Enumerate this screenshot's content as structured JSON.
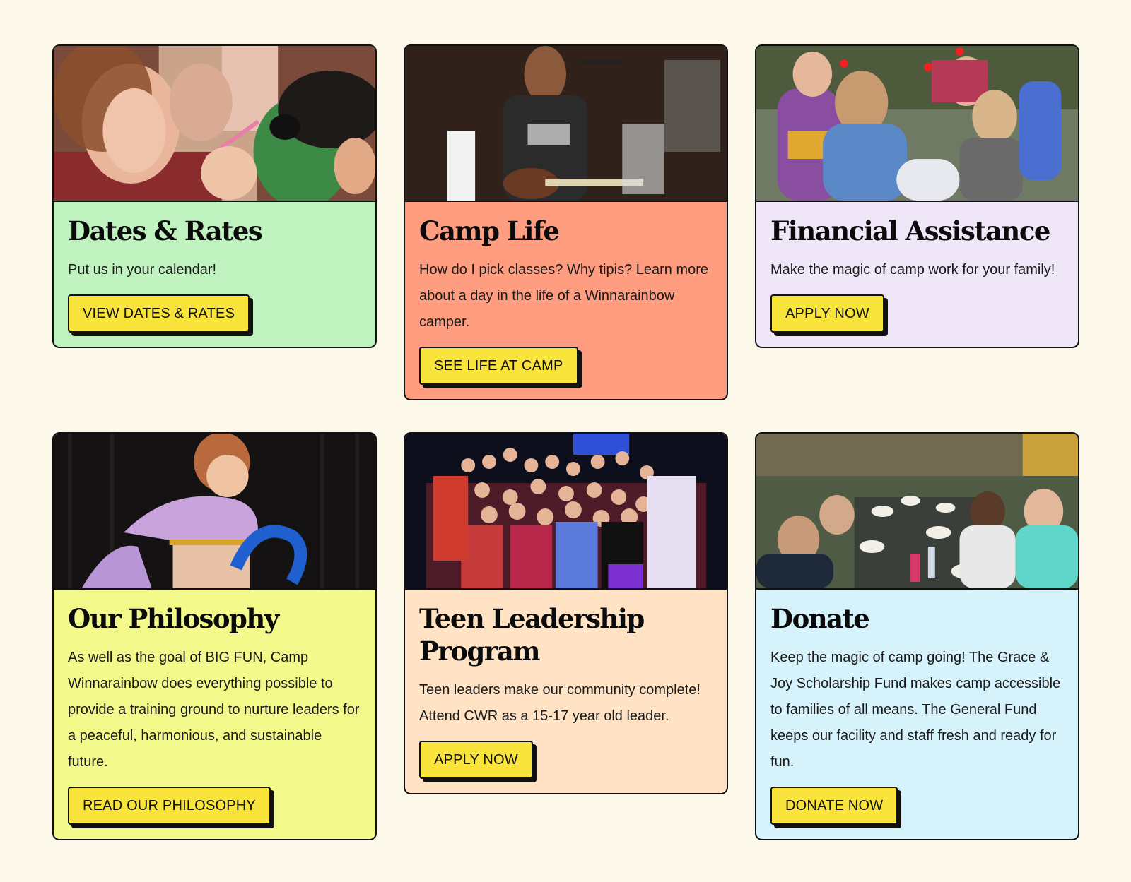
{
  "colors": {
    "background": "#fcf9ea",
    "button": "#f9e43b",
    "border": "#111111",
    "card_green": "#c0f2c0",
    "card_salmon": "#ff9d80",
    "card_lavender": "#efe6f8",
    "card_yellow": "#f2f88a",
    "card_peach": "#ffe3c4",
    "card_lightblue": "#d6f2fb"
  },
  "cards": [
    {
      "title": "Dates & Rates",
      "body": "Put us in your calendar!",
      "button": "VIEW DATES & RATES",
      "photo": "camper-face-painting-photo"
    },
    {
      "title": "Camp Life",
      "body": "How do I pick classes? Why tipis? Learn more about a day in the life of a Winnarainbow camper.",
      "button": "SEE LIFE AT CAMP",
      "photo": "camper-playing-ukulele-photo"
    },
    {
      "title": "Financial Assistance",
      "body": "Make the magic of camp work for your family!",
      "button": "APPLY NOW",
      "photo": "campers-clown-noses-photo"
    },
    {
      "title": "Our Philosophy",
      "body": "As well as the goal of BIG FUN, Camp Winnarainbow does everything possible to provide a training ground to nurture leaders for a peaceful, harmonious, and sustainable future.",
      "button": "READ OUR PHILOSOPHY",
      "photo": "child-hula-hoop-photo"
    },
    {
      "title": "Teen Leadership Program",
      "body": "Teen leaders make our community complete! Attend CWR as a 15-17 year old leader.",
      "button": "APPLY NOW",
      "photo": "teen-leaders-group-photo"
    },
    {
      "title": "Donate",
      "body": "Keep the magic of camp going! The Grace & Joy Scholarship Fund makes camp accessible to families of all means. The General Fund keeps our facility and staff fresh and ready for fun.",
      "button": "DONATE NOW",
      "photo": "campers-picnic-table-photo"
    }
  ]
}
